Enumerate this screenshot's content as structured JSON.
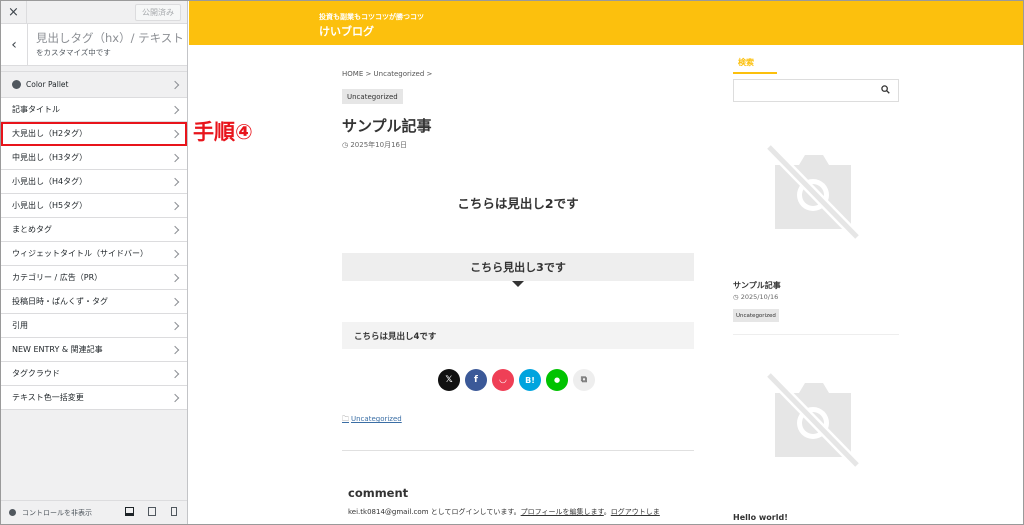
{
  "sidebar": {
    "close_icon": "×",
    "publish_label": "公開済み",
    "back_icon": "‹",
    "section_title": "見出しタグ（hx）/ テキスト",
    "section_subtitle": "をカスタマイズ中です",
    "items": [
      {
        "label": "Color Pallet"
      },
      {
        "label": "記事タイトル"
      },
      {
        "label": "大見出し（H2タグ）"
      },
      {
        "label": "中見出し（H3タグ）"
      },
      {
        "label": "小見出し（H4タグ）"
      },
      {
        "label": "小見出し（H5タグ）"
      },
      {
        "label": "まとめタグ"
      },
      {
        "label": "ウィジェットタイトル（サイドバー）"
      },
      {
        "label": "カテゴリー / 広告（PR）"
      },
      {
        "label": "投稿日時・ぱんくず・タグ"
      },
      {
        "label": "引用"
      },
      {
        "label": "NEW ENTRY & 関連記事"
      },
      {
        "label": "タグクラウド"
      },
      {
        "label": "テキスト色一括変更"
      }
    ],
    "footer_label": "コントロールを非表示"
  },
  "annotation": "手順④",
  "site": {
    "tagline": "投資も副業もコツコツが勝つコツ",
    "name": "けいブログ",
    "accent": "#fcc00d"
  },
  "post": {
    "breadcrumb": "HOME > Uncategorized >",
    "category": "Uncategorized",
    "title": "サンプル記事",
    "date": "2025年10月16日",
    "h2": "こちらは見出し2です",
    "h3": "こちら見出し3です",
    "h4": "こちらは見出し4です",
    "share": [
      {
        "icon": "x-icon",
        "label": "𝕏",
        "color": "#111111"
      },
      {
        "icon": "facebook-icon",
        "label": "f",
        "color": "#3b5998"
      },
      {
        "icon": "pocket-icon",
        "label": "◡",
        "color": "#ef3f56"
      },
      {
        "icon": "hatena-icon",
        "label": "B!",
        "color": "#00a4de"
      },
      {
        "icon": "line-icon",
        "label": "●",
        "color": "#00c300"
      },
      {
        "icon": "copy-icon",
        "label": "⧉",
        "color": "#eeeeee"
      }
    ],
    "tag": "Uncategorized",
    "comment_heading": "comment",
    "comment_text_pre": "kei.tk0814@gmail.com としてログインしています。",
    "comment_link1": "プロフィールを編集します",
    "comment_text_mid": "。",
    "comment_link2": "ログアウトしま"
  },
  "side": {
    "search_heading": "検索",
    "post1_title": "サンプル記事",
    "post1_date": "2025/10/16",
    "post1_category": "Uncategorized",
    "post2_title": "Hello world!"
  }
}
